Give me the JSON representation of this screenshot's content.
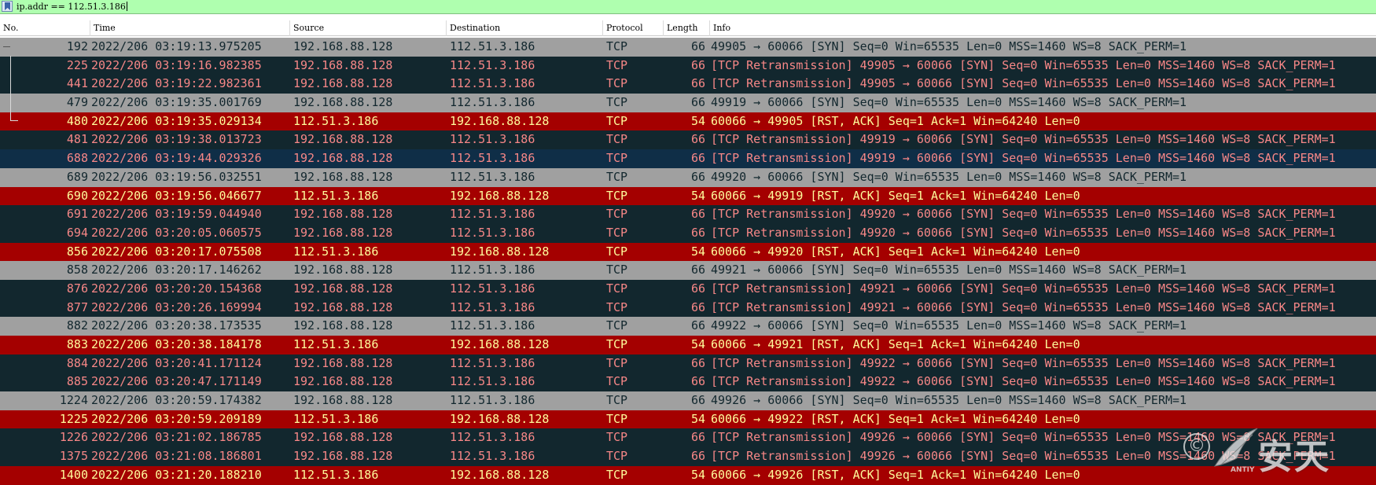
{
  "filter": {
    "value": "ip.addr == 112.51.3.186"
  },
  "columns": [
    "No.",
    "Time",
    "Source",
    "Destination",
    "Protocol",
    "Length",
    "Info"
  ],
  "colors": {
    "syn": "#a0a0a0",
    "retransmission": "#12272e",
    "rst": "#a40000",
    "filter_ok": "#afffaf"
  },
  "packets": [
    {
      "no": "192",
      "time": "2022/206 03:19:13.975205",
      "src": "192.168.88.128",
      "dst": "112.51.3.186",
      "proto": "TCP",
      "len": "66",
      "info": "49905 → 60066 [SYN] Seq=0 Win=65535 Len=0 MSS=1460 WS=8 SACK_PERM=1",
      "kind": "syn"
    },
    {
      "no": "225",
      "time": "2022/206 03:19:16.982385",
      "src": "192.168.88.128",
      "dst": "112.51.3.186",
      "proto": "TCP",
      "len": "66",
      "info": "[TCP Retransmission] 49905 → 60066 [SYN] Seq=0 Win=65535 Len=0 MSS=1460 WS=8 SACK_PERM=1",
      "kind": "retx"
    },
    {
      "no": "441",
      "time": "2022/206 03:19:22.982361",
      "src": "192.168.88.128",
      "dst": "112.51.3.186",
      "proto": "TCP",
      "len": "66",
      "info": "[TCP Retransmission] 49905 → 60066 [SYN] Seq=0 Win=65535 Len=0 MSS=1460 WS=8 SACK_PERM=1",
      "kind": "retx"
    },
    {
      "no": "479",
      "time": "2022/206 03:19:35.001769",
      "src": "192.168.88.128",
      "dst": "112.51.3.186",
      "proto": "TCP",
      "len": "66",
      "info": "49919 → 60066 [SYN] Seq=0 Win=65535 Len=0 MSS=1460 WS=8 SACK_PERM=1",
      "kind": "syn"
    },
    {
      "no": "480",
      "time": "2022/206 03:19:35.029134",
      "src": "112.51.3.186",
      "dst": "192.168.88.128",
      "proto": "TCP",
      "len": "54",
      "info": "60066 → 49905 [RST, ACK] Seq=1 Ack=1 Win=64240 Len=0",
      "kind": "rst"
    },
    {
      "no": "481",
      "time": "2022/206 03:19:38.013723",
      "src": "192.168.88.128",
      "dst": "112.51.3.186",
      "proto": "TCP",
      "len": "66",
      "info": "[TCP Retransmission] 49919 → 60066 [SYN] Seq=0 Win=65535 Len=0 MSS=1460 WS=8 SACK_PERM=1",
      "kind": "retx"
    },
    {
      "no": "688",
      "time": "2022/206 03:19:44.029326",
      "src": "192.168.88.128",
      "dst": "112.51.3.186",
      "proto": "TCP",
      "len": "66",
      "info": "[TCP Retransmission] 49919 → 60066 [SYN] Seq=0 Win=65535 Len=0 MSS=1460 WS=8 SACK_PERM=1",
      "kind": "retx sel"
    },
    {
      "no": "689",
      "time": "2022/206 03:19:56.032551",
      "src": "192.168.88.128",
      "dst": "112.51.3.186",
      "proto": "TCP",
      "len": "66",
      "info": "49920 → 60066 [SYN] Seq=0 Win=65535 Len=0 MSS=1460 WS=8 SACK_PERM=1",
      "kind": "syn"
    },
    {
      "no": "690",
      "time": "2022/206 03:19:56.046677",
      "src": "112.51.3.186",
      "dst": "192.168.88.128",
      "proto": "TCP",
      "len": "54",
      "info": "60066 → 49919 [RST, ACK] Seq=1 Ack=1 Win=64240 Len=0",
      "kind": "rst"
    },
    {
      "no": "691",
      "time": "2022/206 03:19:59.044940",
      "src": "192.168.88.128",
      "dst": "112.51.3.186",
      "proto": "TCP",
      "len": "66",
      "info": "[TCP Retransmission] 49920 → 60066 [SYN] Seq=0 Win=65535 Len=0 MSS=1460 WS=8 SACK_PERM=1",
      "kind": "retx"
    },
    {
      "no": "694",
      "time": "2022/206 03:20:05.060575",
      "src": "192.168.88.128",
      "dst": "112.51.3.186",
      "proto": "TCP",
      "len": "66",
      "info": "[TCP Retransmission] 49920 → 60066 [SYN] Seq=0 Win=65535 Len=0 MSS=1460 WS=8 SACK_PERM=1",
      "kind": "retx"
    },
    {
      "no": "856",
      "time": "2022/206 03:20:17.075508",
      "src": "112.51.3.186",
      "dst": "192.168.88.128",
      "proto": "TCP",
      "len": "54",
      "info": "60066 → 49920 [RST, ACK] Seq=1 Ack=1 Win=64240 Len=0",
      "kind": "rst"
    },
    {
      "no": "858",
      "time": "2022/206 03:20:17.146262",
      "src": "192.168.88.128",
      "dst": "112.51.3.186",
      "proto": "TCP",
      "len": "66",
      "info": "49921 → 60066 [SYN] Seq=0 Win=65535 Len=0 MSS=1460 WS=8 SACK_PERM=1",
      "kind": "syn"
    },
    {
      "no": "876",
      "time": "2022/206 03:20:20.154368",
      "src": "192.168.88.128",
      "dst": "112.51.3.186",
      "proto": "TCP",
      "len": "66",
      "info": "[TCP Retransmission] 49921 → 60066 [SYN] Seq=0 Win=65535 Len=0 MSS=1460 WS=8 SACK_PERM=1",
      "kind": "retx"
    },
    {
      "no": "877",
      "time": "2022/206 03:20:26.169994",
      "src": "192.168.88.128",
      "dst": "112.51.3.186",
      "proto": "TCP",
      "len": "66",
      "info": "[TCP Retransmission] 49921 → 60066 [SYN] Seq=0 Win=65535 Len=0 MSS=1460 WS=8 SACK_PERM=1",
      "kind": "retx"
    },
    {
      "no": "882",
      "time": "2022/206 03:20:38.173535",
      "src": "192.168.88.128",
      "dst": "112.51.3.186",
      "proto": "TCP",
      "len": "66",
      "info": "49922 → 60066 [SYN] Seq=0 Win=65535 Len=0 MSS=1460 WS=8 SACK_PERM=1",
      "kind": "syn"
    },
    {
      "no": "883",
      "time": "2022/206 03:20:38.184178",
      "src": "112.51.3.186",
      "dst": "192.168.88.128",
      "proto": "TCP",
      "len": "54",
      "info": "60066 → 49921 [RST, ACK] Seq=1 Ack=1 Win=64240 Len=0",
      "kind": "rst"
    },
    {
      "no": "884",
      "time": "2022/206 03:20:41.171124",
      "src": "192.168.88.128",
      "dst": "112.51.3.186",
      "proto": "TCP",
      "len": "66",
      "info": "[TCP Retransmission] 49922 → 60066 [SYN] Seq=0 Win=65535 Len=0 MSS=1460 WS=8 SACK_PERM=1",
      "kind": "retx"
    },
    {
      "no": "885",
      "time": "2022/206 03:20:47.171149",
      "src": "192.168.88.128",
      "dst": "112.51.3.186",
      "proto": "TCP",
      "len": "66",
      "info": "[TCP Retransmission] 49922 → 60066 [SYN] Seq=0 Win=65535 Len=0 MSS=1460 WS=8 SACK_PERM=1",
      "kind": "retx"
    },
    {
      "no": "1224",
      "time": "2022/206 03:20:59.174382",
      "src": "192.168.88.128",
      "dst": "112.51.3.186",
      "proto": "TCP",
      "len": "66",
      "info": "49926 → 60066 [SYN] Seq=0 Win=65535 Len=0 MSS=1460 WS=8 SACK_PERM=1",
      "kind": "syn"
    },
    {
      "no": "1225",
      "time": "2022/206 03:20:59.209189",
      "src": "112.51.3.186",
      "dst": "192.168.88.128",
      "proto": "TCP",
      "len": "54",
      "info": "60066 → 49922 [RST, ACK] Seq=1 Ack=1 Win=64240 Len=0",
      "kind": "rst"
    },
    {
      "no": "1226",
      "time": "2022/206 03:21:02.186785",
      "src": "192.168.88.128",
      "dst": "112.51.3.186",
      "proto": "TCP",
      "len": "66",
      "info": "[TCP Retransmission] 49926 → 60066 [SYN] Seq=0 Win=65535 Len=0 MSS=1460 WS=8 SACK_PERM=1",
      "kind": "retx"
    },
    {
      "no": "1375",
      "time": "2022/206 03:21:08.186801",
      "src": "192.168.88.128",
      "dst": "112.51.3.186",
      "proto": "TCP",
      "len": "66",
      "info": "[TCP Retransmission] 49926 → 60066 [SYN] Seq=0 Win=65535 Len=0 MSS=1460 WS=8 SACK_PERM=1",
      "kind": "retx"
    },
    {
      "no": "1400",
      "time": "2022/206 03:21:20.188210",
      "src": "112.51.3.186",
      "dst": "192.168.88.128",
      "proto": "TCP",
      "len": "54",
      "info": "60066 → 49926 [RST, ACK] Seq=1 Ack=1 Win=64240 Len=0",
      "kind": "rst"
    }
  ],
  "watermark": {
    "text": "安天",
    "small": "ANTIY",
    "circle": "©"
  }
}
